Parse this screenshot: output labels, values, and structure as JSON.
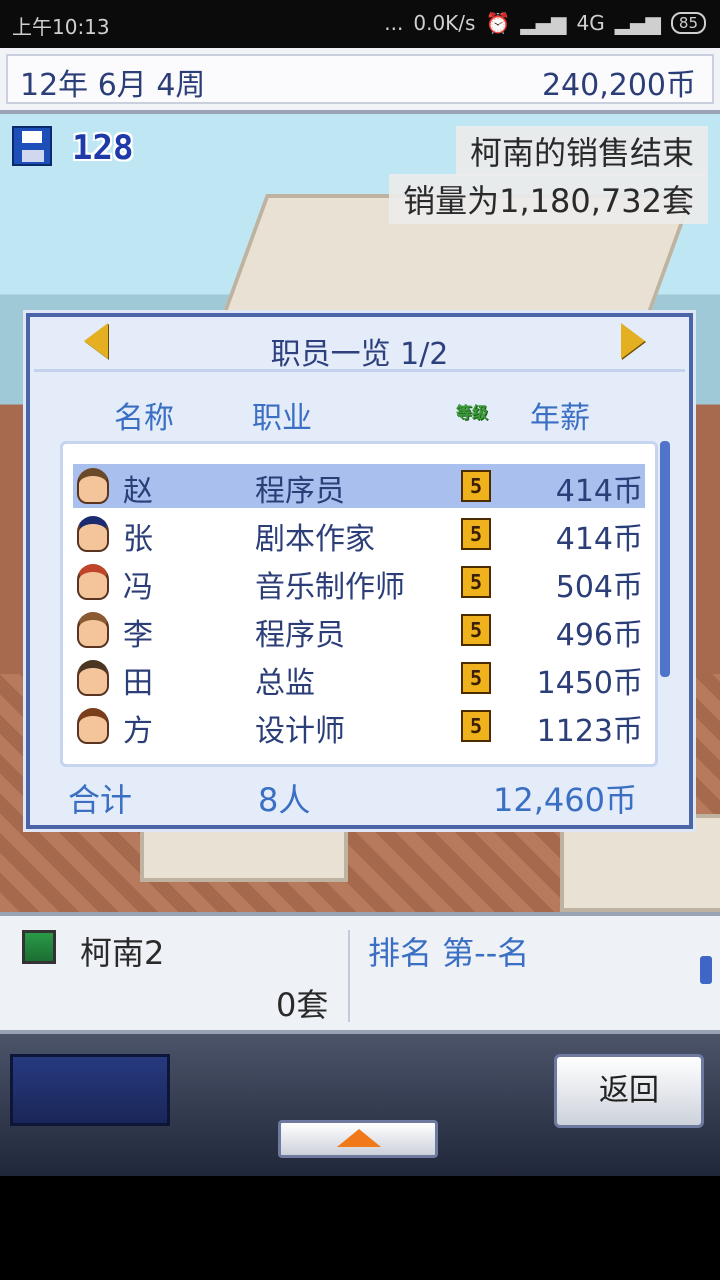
{
  "status_bar": {
    "time": "上午10:13",
    "dots": "...",
    "net_speed": "0.0K/s",
    "network": "4G",
    "battery": "85"
  },
  "top_bar": {
    "date": "12年 6月 4周",
    "money": "240,200币"
  },
  "hud": {
    "points": "128",
    "notice_line1": "柯南的销售结束",
    "notice_line2": "销量为1,180,732套"
  },
  "dialog": {
    "title": "职员一览 1/2",
    "headers": {
      "name": "名称",
      "job": "职业",
      "level": "等级",
      "salary": "年薪"
    },
    "rows": [
      {
        "name": "赵",
        "job": "程序员",
        "level": "5",
        "salary": "414币",
        "hair": "#6b4a2a",
        "selected": true
      },
      {
        "name": "张",
        "job": "剧本作家",
        "level": "5",
        "salary": "414币",
        "hair": "#1c2a70"
      },
      {
        "name": "冯",
        "job": "音乐制作师",
        "level": "5",
        "salary": "504币",
        "hair": "#c0442a"
      },
      {
        "name": "李",
        "job": "程序员",
        "level": "5",
        "salary": "496币",
        "hair": "#8a5a32"
      },
      {
        "name": "田",
        "job": "总监",
        "level": "5",
        "salary": "1450币",
        "hair": "#4a3422"
      },
      {
        "name": "方",
        "job": "设计师",
        "level": "5",
        "salary": "1123币",
        "hair": "#7a3e1a"
      }
    ],
    "total_label": "合计",
    "total_count": "8人",
    "total_salary": "12,460币"
  },
  "info_panel": {
    "game_name": "柯南2",
    "sales": "0套",
    "rank": "排名 第--名"
  },
  "buttons": {
    "back": "返回"
  },
  "colors": {
    "dialog_border": "#4b64a8",
    "header_text": "#3a6fc4",
    "level_badge": "#f0b21c",
    "selected_row": "#a9c0ef"
  }
}
